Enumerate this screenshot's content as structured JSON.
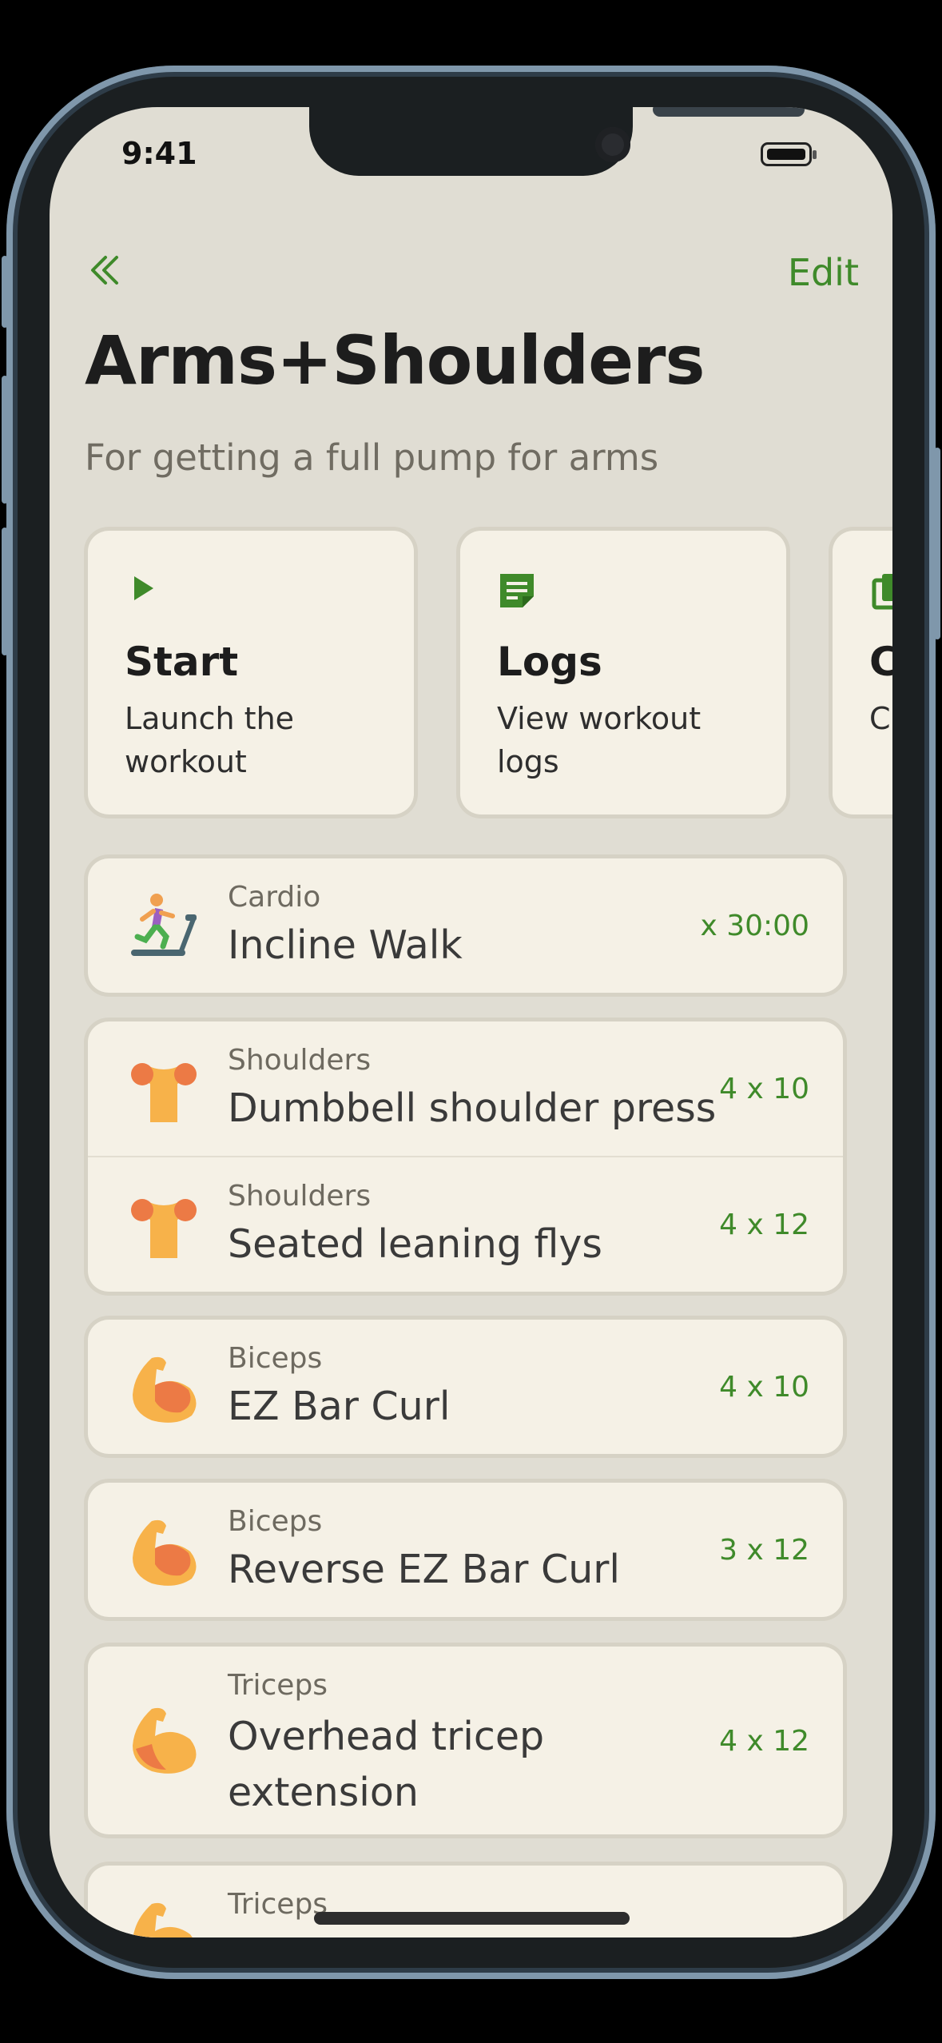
{
  "status": {
    "time": "9:41"
  },
  "nav": {
    "back_icon": "chevron-double-left-icon",
    "edit_label": "Edit"
  },
  "header": {
    "title": "Arms+Shoulders",
    "subtitle": "For getting a full pump for arms"
  },
  "actions": [
    {
      "icon": "play-icon",
      "title": "Start",
      "desc": "Launch the workout"
    },
    {
      "icon": "notes-icon",
      "title": "Logs",
      "desc": "View workout logs"
    },
    {
      "icon": "copy-icon",
      "title": "C",
      "desc": "C w"
    }
  ],
  "groups": [
    [
      {
        "icon": "treadmill-runner-icon",
        "category": "Cardio",
        "name": "Incline Walk",
        "sets": "x 30:00"
      }
    ],
    [
      {
        "icon": "shoulders-icon",
        "category": "Shoulders",
        "name": "Dumbbell shoulder press",
        "sets": "4 x 10"
      },
      {
        "icon": "shoulders-icon",
        "category": "Shoulders",
        "name": "Seated leaning flys",
        "sets": "4 x 12"
      }
    ],
    [
      {
        "icon": "flexed-biceps-icon",
        "category": "Biceps",
        "name": "EZ Bar Curl",
        "sets": "4 x 10"
      }
    ],
    [
      {
        "icon": "flexed-biceps-icon",
        "category": "Biceps",
        "name": "Reverse EZ Bar Curl",
        "sets": "3 x 12"
      }
    ],
    [
      {
        "icon": "flexed-biceps-icon",
        "category": "Triceps",
        "name": "Overhead tricep extension",
        "sets": "4 x 12"
      }
    ],
    [
      {
        "icon": "flexed-biceps-icon",
        "category": "Triceps",
        "name": "",
        "sets": ""
      }
    ]
  ],
  "colors": {
    "accent": "#3f8a2a",
    "background": "#e0ddd3",
    "card": "#f5f1e6"
  }
}
